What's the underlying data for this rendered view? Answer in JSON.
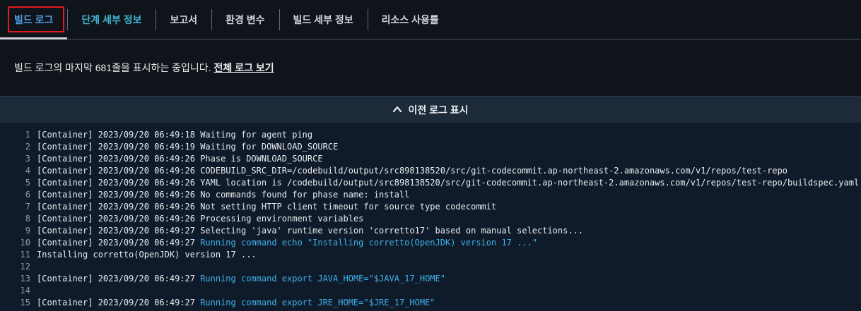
{
  "tabs": [
    {
      "label": "빌드 로그"
    },
    {
      "label": "단계 세부 정보"
    },
    {
      "label": "보고서"
    },
    {
      "label": "환경 변수"
    },
    {
      "label": "빌드 세부 정보"
    },
    {
      "label": "리소스 사용률"
    }
  ],
  "info": {
    "text": "빌드 로그의 마지막 681줄을 표시하는 중입니다.",
    "link": "전체 로그 보기"
  },
  "prev_logs": {
    "label": "이전 로그 표시"
  },
  "log_lines": [
    {
      "n": "1",
      "prefix": "[Container] 2023/09/20 06:49:18 Waiting for agent ping",
      "cmd": ""
    },
    {
      "n": "2",
      "prefix": "[Container] 2023/09/20 06:49:19 Waiting for DOWNLOAD_SOURCE",
      "cmd": ""
    },
    {
      "n": "3",
      "prefix": "[Container] 2023/09/20 06:49:26 Phase is DOWNLOAD_SOURCE",
      "cmd": ""
    },
    {
      "n": "4",
      "prefix": "[Container] 2023/09/20 06:49:26 CODEBUILD_SRC_DIR=/codebuild/output/src898138520/src/git-codecommit.ap-northeast-2.amazonaws.com/v1/repos/test-repo",
      "cmd": ""
    },
    {
      "n": "5",
      "prefix": "[Container] 2023/09/20 06:49:26 YAML location is /codebuild/output/src898138520/src/git-codecommit.ap-northeast-2.amazonaws.com/v1/repos/test-repo/buildspec.yaml",
      "cmd": ""
    },
    {
      "n": "6",
      "prefix": "[Container] 2023/09/20 06:49:26 No commands found for phase name: install",
      "cmd": ""
    },
    {
      "n": "7",
      "prefix": "[Container] 2023/09/20 06:49:26 Not setting HTTP client timeout for source type codecommit",
      "cmd": ""
    },
    {
      "n": "8",
      "prefix": "[Container] 2023/09/20 06:49:26 Processing environment variables",
      "cmd": ""
    },
    {
      "n": "9",
      "prefix": "[Container] 2023/09/20 06:49:27 Selecting 'java' runtime version 'corretto17' based on manual selections...",
      "cmd": ""
    },
    {
      "n": "10",
      "prefix": "[Container] 2023/09/20 06:49:27 ",
      "cmd": "Running command echo \"Installing corretto(OpenJDK) version 17 ...\""
    },
    {
      "n": "11",
      "prefix": "Installing corretto(OpenJDK) version 17 ...",
      "cmd": ""
    },
    {
      "n": "12",
      "prefix": "",
      "cmd": ""
    },
    {
      "n": "13",
      "prefix": "[Container] 2023/09/20 06:49:27 ",
      "cmd": "Running command export JAVA_HOME=\"$JAVA_17_HOME\""
    },
    {
      "n": "14",
      "prefix": "",
      "cmd": ""
    },
    {
      "n": "15",
      "prefix": "[Container] 2023/09/20 06:49:27 ",
      "cmd": "Running command export JRE_HOME=\"$JRE_17_HOME\""
    }
  ],
  "colors": {
    "accent": "#539fe5",
    "command": "#3fb1e8",
    "focus_outline": "#e0191c"
  }
}
